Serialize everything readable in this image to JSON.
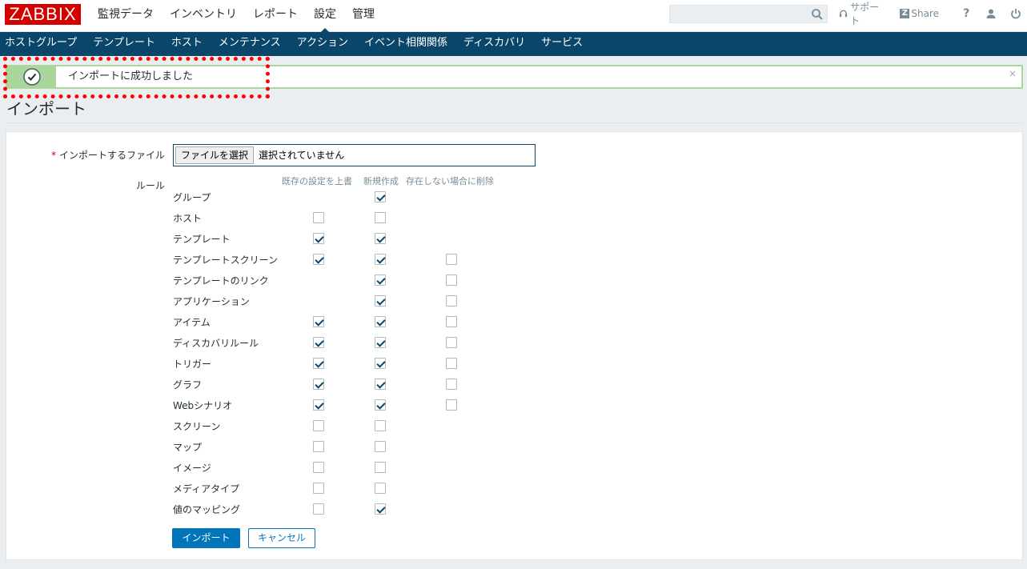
{
  "header": {
    "logo": "ZABBIX",
    "main_nav": [
      "監視データ",
      "インベントリ",
      "レポート",
      "設定",
      "管理"
    ],
    "active_main": "設定",
    "search_placeholder": "",
    "support_label": "サポート",
    "share_label": "Share",
    "help_label": "?"
  },
  "sub_nav": [
    "ホストグループ",
    "テンプレート",
    "ホスト",
    "メンテナンス",
    "アクション",
    "イベント相関関係",
    "ディスカバリ",
    "サービス"
  ],
  "message": {
    "text": "インポートに成功しました",
    "close": "×"
  },
  "page": {
    "title": "インポート"
  },
  "form": {
    "file_label": "インポートするファイル",
    "required_mark": "*",
    "file_button": "ファイルを選択",
    "file_status": "選択されていません",
    "rules_label": "ルール",
    "columns": [
      "既存の設定を上書",
      "新規作成",
      "存在しない場合に削除"
    ],
    "rules": [
      {
        "label": "グループ",
        "update": null,
        "create": true,
        "delete": null
      },
      {
        "label": "ホスト",
        "update": false,
        "create": false,
        "delete": null
      },
      {
        "label": "テンプレート",
        "update": true,
        "create": true,
        "delete": null
      },
      {
        "label": "テンプレートスクリーン",
        "update": true,
        "create": true,
        "delete": false
      },
      {
        "label": "テンプレートのリンク",
        "update": null,
        "create": true,
        "delete": false
      },
      {
        "label": "アプリケーション",
        "update": null,
        "create": true,
        "delete": false
      },
      {
        "label": "アイテム",
        "update": true,
        "create": true,
        "delete": false
      },
      {
        "label": "ディスカバリルール",
        "update": true,
        "create": true,
        "delete": false
      },
      {
        "label": "トリガー",
        "update": true,
        "create": true,
        "delete": false
      },
      {
        "label": "グラフ",
        "update": true,
        "create": true,
        "delete": false
      },
      {
        "label": "Webシナリオ",
        "update": true,
        "create": true,
        "delete": false
      },
      {
        "label": "スクリーン",
        "update": false,
        "create": false,
        "delete": null
      },
      {
        "label": "マップ",
        "update": false,
        "create": false,
        "delete": null
      },
      {
        "label": "イメージ",
        "update": false,
        "create": false,
        "delete": null
      },
      {
        "label": "メディアタイプ",
        "update": false,
        "create": false,
        "delete": null
      },
      {
        "label": "値のマッピング",
        "update": false,
        "create": true,
        "delete": null
      }
    ],
    "import_button": "インポート",
    "cancel_button": "キャンセル"
  },
  "colors": {
    "brand": "#d40000",
    "subnav_bg": "#0a466a",
    "success_border": "#a9d69a",
    "primary_button": "#0275b8"
  }
}
